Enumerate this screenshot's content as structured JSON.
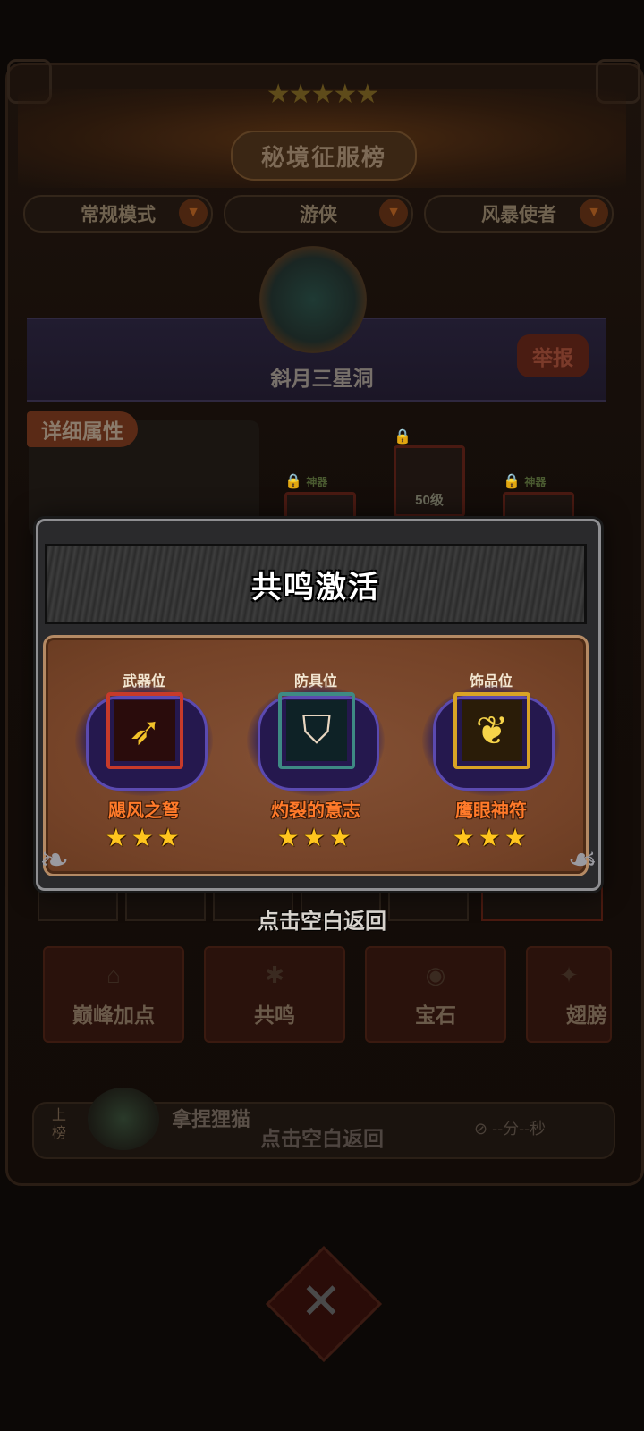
{
  "background": {
    "leaderboard_title": "秘境征服榜",
    "title_stars": "★★★★★",
    "filters": [
      {
        "label": "常规模式"
      },
      {
        "label": "游侠"
      },
      {
        "label": "风暴使者"
      }
    ],
    "stage_name": "斜月三星洞",
    "report_button": "举报",
    "detail_tab": "详细属性",
    "locked_slots": [
      {
        "tag": "神器",
        "lock": "🔒"
      },
      {
        "level": "50级",
        "lock": "🔒"
      },
      {
        "tag": "神器",
        "lock": "🔒"
      }
    ],
    "action_buttons": [
      {
        "label": "巅峰加点",
        "icon": "⌂"
      },
      {
        "label": "共鸣",
        "icon": "✱"
      },
      {
        "label": "宝石",
        "icon": "◉"
      },
      {
        "label": "翅膀",
        "icon": "✦"
      }
    ],
    "rank_label": "上榜",
    "player_name": "拿捏狸猫",
    "tap_hint_behind": "点击空白返回",
    "timer": "⊘ --分--秒",
    "close_symbol": "✕"
  },
  "modal": {
    "title": "共鸣激活",
    "slots": [
      {
        "position": "武器位",
        "name": "飓风之弩",
        "icon": "crossbow-icon",
        "glyph": "➶",
        "frame_color": "#c73a2a",
        "inner_bg": "#2a0c0c",
        "glyph_color": "#f2c22a",
        "stars": "★★★"
      },
      {
        "position": "防具位",
        "name": "灼裂的意志",
        "icon": "armor-icon",
        "glyph": "⛉",
        "frame_color": "#3e8a84",
        "inner_bg": "#0e2226",
        "glyph_color": "#e8d6c0",
        "stars": "★★★"
      },
      {
        "position": "饰品位",
        "name": "鹰眼神符",
        "icon": "eagle-amulet-icon",
        "glyph": "❦",
        "frame_color": "#d9a325",
        "inner_bg": "#2a1c08",
        "glyph_color": "#f6d44a",
        "stars": "★★★"
      }
    ]
  },
  "tap_hint": "点击空白返回"
}
